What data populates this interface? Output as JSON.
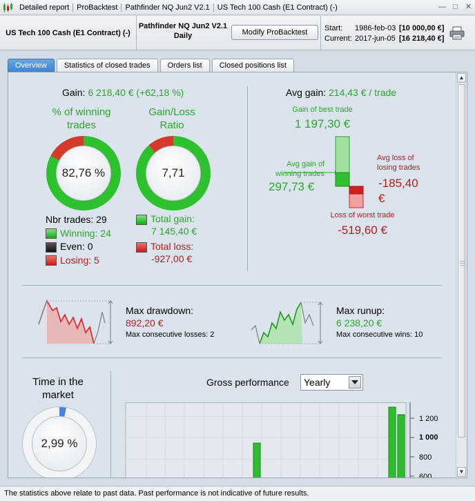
{
  "titlebar": {
    "items": [
      "Detailed report",
      "ProBacktest",
      "Pathfinder NQ Jun2 V2.1",
      "US Tech 100 Cash (E1 Contract) (-)"
    ]
  },
  "header": {
    "instrument": "US Tech 100 Cash (E1 Contract) (-)",
    "system_name": "Pathfinder NQ Jun2 V2.1",
    "timeframe": "Daily",
    "modify_label": "Modify ProBacktest",
    "start_label": "Start:",
    "start_date": "1986-feb-03",
    "start_value": "[10 000,00 €]",
    "current_label": "Current:",
    "current_date": "2017-jun-05",
    "current_value": "[16 218,40 €]"
  },
  "tabs": [
    "Overview",
    "Statistics of closed trades",
    "Orders list",
    "Closed positions list"
  ],
  "overview": {
    "gain_label": "Gain:",
    "gain_value": "6 218,40 € (+62,18 %)",
    "win_title_1": "% of winning",
    "win_title_2": "trades",
    "win_pct": "82,76 %",
    "win_fraction": 0.8276,
    "ratio_title_1": "Gain/Loss",
    "ratio_title_2": "Ratio",
    "ratio_value": "7,71",
    "ratio_gain_fraction": 0.885,
    "nbr_trades": "Nbr trades: 29",
    "winning": "Winning: 24",
    "even": "Even: 0",
    "losing": "Losing: 5",
    "total_gain_label": "Total gain:",
    "total_gain_value": "7 145,40 €",
    "total_loss_label": "Total loss:",
    "total_loss_value": "-927,00 €",
    "avg_gain_label": "Avg gain:",
    "avg_gain_value": "214,43 € / trade",
    "best_label": "Gain of best trade",
    "best_value": "1 197,30 €",
    "avg_win_label_1": "Avg gain of",
    "avg_win_label_2": "winning trades",
    "avg_win_value": "297,73 €",
    "avg_loss_label_1": "Avg loss of",
    "avg_loss_label_2": "losing trades",
    "avg_loss_value_1": "-185,40",
    "avg_loss_value_2": "€",
    "worst_label": "Loss of worst trade",
    "worst_value": "-519,60 €",
    "drawdown_label": "Max drawdown:",
    "drawdown_value": "892,20 €",
    "consec_losses": "Max consecutive losses: 2",
    "runup_label": "Max runup:",
    "runup_value": "6 238,20 €",
    "consec_wins": "Max consecutive wins: 10",
    "time_label_1": "Time in the",
    "time_label_2": "market",
    "time_value": "2,99 %",
    "time_fraction": 0.0299,
    "gross_label": "Gross performance",
    "period_option": "Yearly"
  },
  "chart_data": {
    "type": "bar",
    "title": "Gross performance",
    "yticks": [
      "1 200",
      "1 000",
      "800",
      "600"
    ],
    "series": [
      {
        "values": [
          950,
          620,
          1285,
          1215
        ]
      }
    ],
    "ylim_visible": [
      590,
      1330
    ],
    "colors": {
      "bar": "#2fbd2f"
    }
  },
  "footer": {
    "disclaimer": "The statistics above relate to past data. Past performance is not indicative of future results."
  }
}
